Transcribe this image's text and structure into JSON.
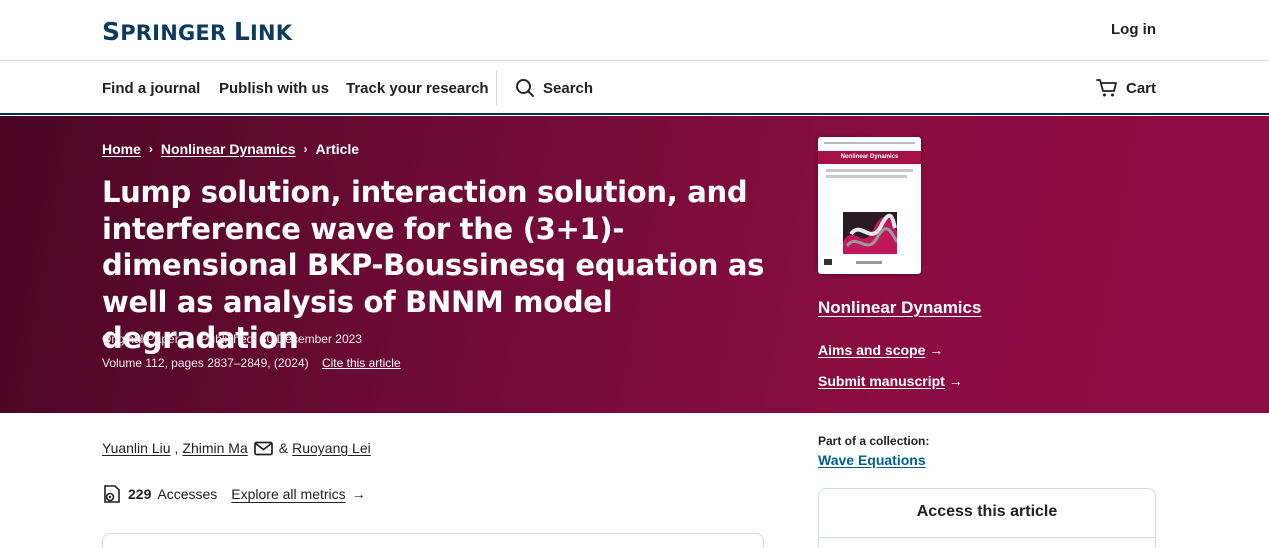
{
  "header": {
    "logo_big1": "S",
    "logo_rest1": "PRINGER ",
    "logo_big2": "L",
    "logo_rest2": "INK",
    "login": "Log in"
  },
  "nav": {
    "items": [
      "Find a journal",
      "Publish with us",
      "Track your research"
    ],
    "search": "Search",
    "cart": "Cart"
  },
  "breadcrumb": {
    "home": "Home",
    "journal": "Nonlinear Dynamics",
    "current": "Article",
    "separator": "›"
  },
  "article": {
    "title": "Lump solution, interaction solution, and interference wave for the (3+1)-dimensional BKP-Boussinesq equation as well as analysis of BNNM model degradation",
    "type": "Original Paper",
    "published": "Published: 30 December 2023",
    "divider": "|",
    "volume": "Volume 112, pages 2837–2849, (2024)",
    "cite": "Cite this article",
    "authors": [
      "Yuanlin Liu",
      "Zhimin Ma",
      "Ruoyang Lei"
    ],
    "author_sep1": ",",
    "author_sep2": "&",
    "accesses_count": "229",
    "accesses_label": "Accesses",
    "metrics_link": "Explore all metrics",
    "arrow": "→"
  },
  "sidebar": {
    "cover_band": "Nonlinear Dynamics",
    "journal": "Nonlinear Dynamics",
    "aims": "Aims and scope",
    "submit": "Submit manuscript",
    "collection_label": "Part of a collection:",
    "collection": "Wave Equations",
    "access_title": "Access this article"
  },
  "colors": {
    "brand": "#0b3b5e",
    "hero_start": "#4a0626",
    "hero_end": "#8e0c44",
    "link": "#025e8d"
  }
}
